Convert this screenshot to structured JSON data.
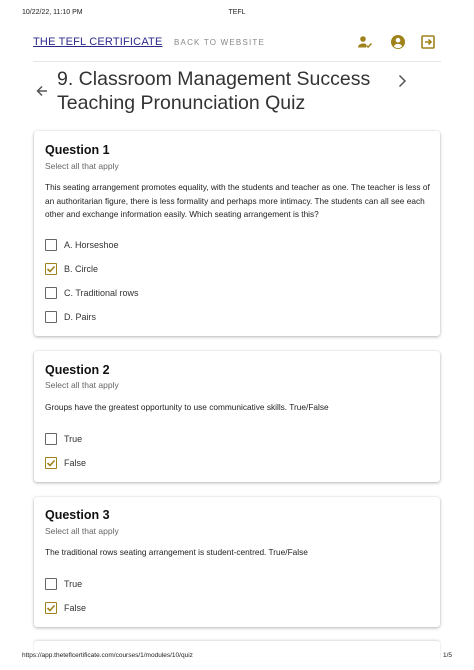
{
  "print_header": {
    "datetime": "10/22/22, 11:10 PM",
    "title": "TEFL"
  },
  "topbar": {
    "brand": "THE TEFL CERTIFICATE",
    "back_link": "BACK TO WEBSITE",
    "icons": [
      "user-check-icon",
      "account-circle-icon",
      "logout-icon"
    ],
    "accent_color": "#a0821a"
  },
  "page": {
    "title": "9. Classroom Management Success Teaching Pronunciation Quiz"
  },
  "questions": [
    {
      "title": "Question 1",
      "subtitle": "Select all that apply",
      "text": "This seating arrangement promotes equality, with the students and teacher as one. The teacher is less of an authoritarian figure, there is less formality and perhaps more intimacy. The students can all see each other and exchange information easily. Which seating arrangement is this?",
      "options": [
        {
          "label": "A. Horseshoe",
          "checked": false
        },
        {
          "label": "B. Circle",
          "checked": true
        },
        {
          "label": "C. Traditional rows",
          "checked": false
        },
        {
          "label": "D. Pairs",
          "checked": false
        }
      ]
    },
    {
      "title": "Question 2",
      "subtitle": "Select all that apply",
      "text": "Groups have the greatest opportunity to use communicative skills. True/False",
      "options": [
        {
          "label": "True",
          "checked": false
        },
        {
          "label": "False",
          "checked": true
        }
      ]
    },
    {
      "title": "Question 3",
      "subtitle": "Select all that apply",
      "text": "The traditional rows seating arrangement is student-centred. True/False",
      "options": [
        {
          "label": "True",
          "checked": false
        },
        {
          "label": "False",
          "checked": true
        }
      ]
    }
  ],
  "print_footer": {
    "url": "https://app.theteflcertificate.com/courses/1/modules/10/quiz",
    "page": "1/5"
  }
}
